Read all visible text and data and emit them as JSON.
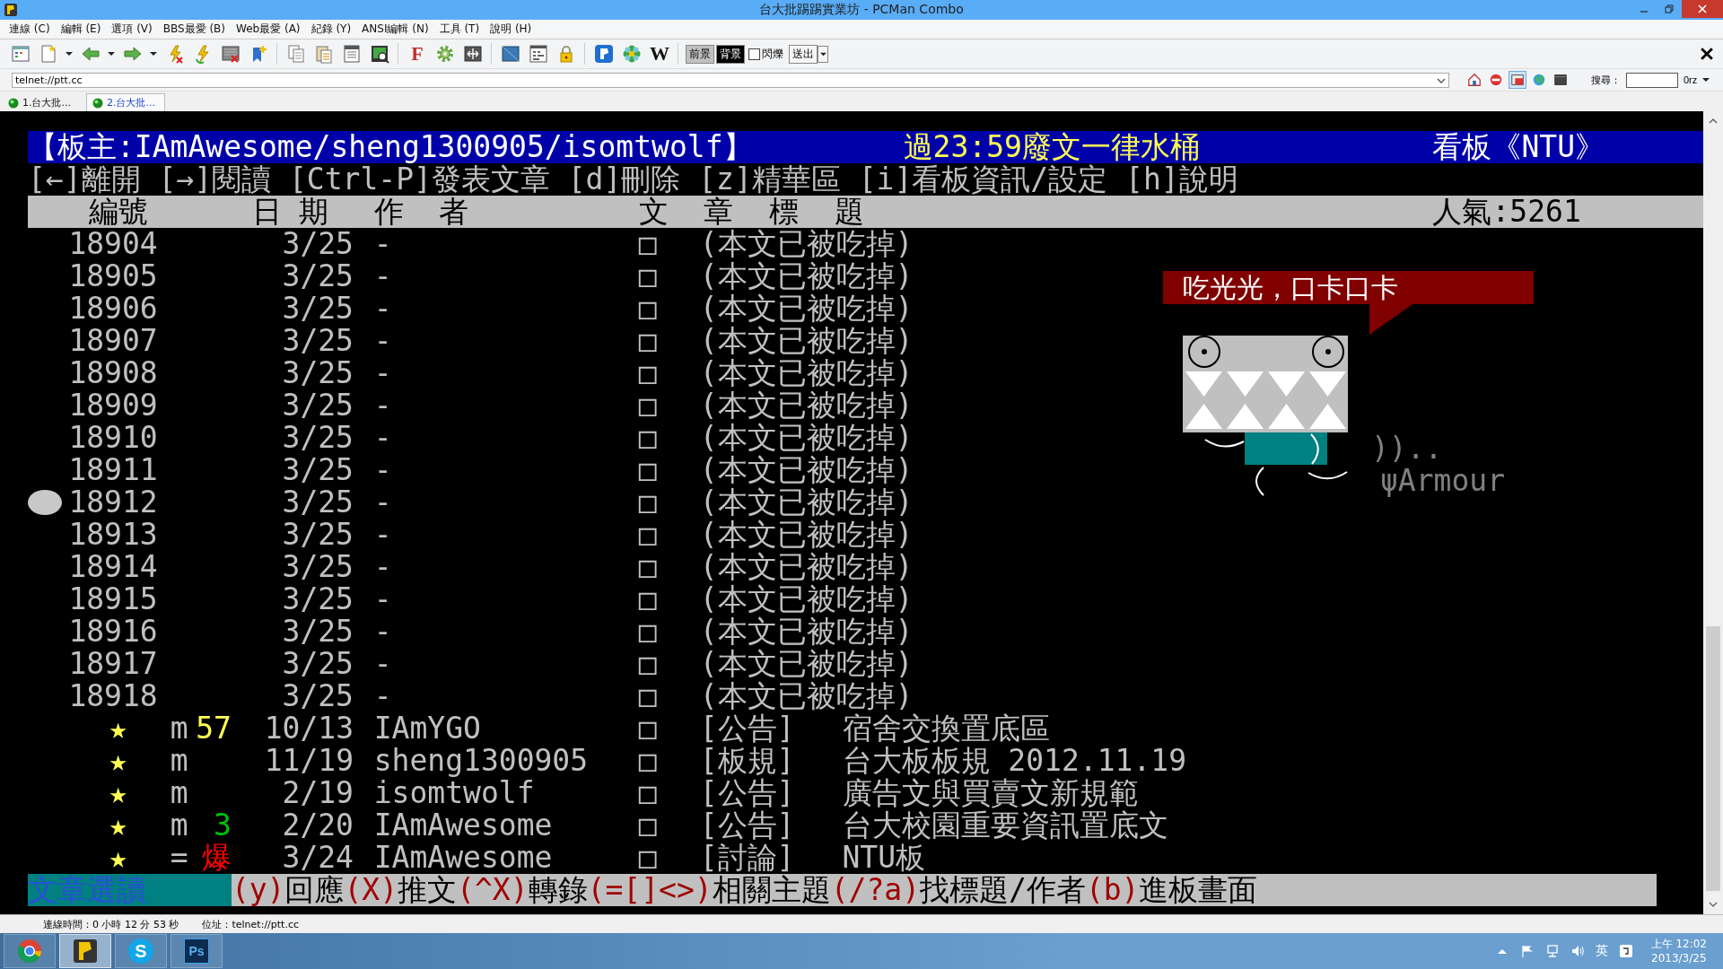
{
  "window": {
    "title": "台大批踢踢實業坊 - PCMan Combo"
  },
  "menu": [
    "連線 (C)",
    "編輯 (E)",
    "選項 (V)",
    "BBS最愛 (B)",
    "Web最愛 (A)",
    "紀錄 (Y)",
    "ANSI編輯 (N)",
    "工具 (T)",
    "說明 (H)"
  ],
  "toolbar": {
    "letters": [
      "F",
      "W"
    ],
    "color_buttons": [
      {
        "label": "前景",
        "color": "#c0c0c0"
      },
      {
        "label": "背景",
        "color": "#000000"
      }
    ],
    "blink": {
      "label": "閃爍",
      "checked": false
    },
    "send": {
      "label": "送出"
    }
  },
  "address": {
    "url": "telnet://ptt.cc"
  },
  "search": {
    "label": "搜尋：",
    "shortener": "0rz"
  },
  "tabs": [
    {
      "label": "1.台大批...",
      "selected": false
    },
    {
      "label": "2.台大批...",
      "selected": true
    }
  ],
  "terminal": {
    "header": {
      "moderator": "【板主:IAmAwesome/sheng1300905/isomtwolf】",
      "notice": "過23:59廢文一律水桶",
      "board": "看板《NTU》"
    },
    "help_line": "[←]離開 [→]閱讀 [Ctrl-P]發表文章 [d]刪除 [z]精華區 [i]看板資訊/設定 [h]說明",
    "columns": [
      "編號",
      "日 期",
      "作  者",
      "文  章  標  題"
    ],
    "popularity": "人氣:5261",
    "posts": [
      {
        "number": "18904",
        "date": "3/25",
        "author": "-",
        "mark": "□",
        "title": "(本文已被吃掉)",
        "selected": false
      },
      {
        "number": "18905",
        "date": "3/25",
        "author": "-",
        "mark": "□",
        "title": "(本文已被吃掉)",
        "selected": false
      },
      {
        "number": "18906",
        "date": "3/25",
        "author": "-",
        "mark": "□",
        "title": "(本文已被吃掉)",
        "selected": false
      },
      {
        "number": "18907",
        "date": "3/25",
        "author": "-",
        "mark": "□",
        "title": "(本文已被吃掉)",
        "selected": false
      },
      {
        "number": "18908",
        "date": "3/25",
        "author": "-",
        "mark": "□",
        "title": "(本文已被吃掉)",
        "selected": false
      },
      {
        "number": "18909",
        "date": "3/25",
        "author": "-",
        "mark": "□",
        "title": "(本文已被吃掉)",
        "selected": false
      },
      {
        "number": "18910",
        "date": "3/25",
        "author": "-",
        "mark": "□",
        "title": "(本文已被吃掉)",
        "selected": false
      },
      {
        "number": "18911",
        "date": "3/25",
        "author": "-",
        "mark": "□",
        "title": "(本文已被吃掉)",
        "selected": false
      },
      {
        "number": "18912",
        "date": "3/25",
        "author": "-",
        "mark": "□",
        "title": "(本文已被吃掉)",
        "selected": true
      },
      {
        "number": "18913",
        "date": "3/25",
        "author": "-",
        "mark": "□",
        "title": "(本文已被吃掉)",
        "selected": false
      },
      {
        "number": "18914",
        "date": "3/25",
        "author": "-",
        "mark": "□",
        "title": "(本文已被吃掉)",
        "selected": false
      },
      {
        "number": "18915",
        "date": "3/25",
        "author": "-",
        "mark": "□",
        "title": "(本文已被吃掉)",
        "selected": false
      },
      {
        "number": "18916",
        "date": "3/25",
        "author": "-",
        "mark": "□",
        "title": "(本文已被吃掉)",
        "selected": false
      },
      {
        "number": "18917",
        "date": "3/25",
        "author": "-",
        "mark": "□",
        "title": "(本文已被吃掉)",
        "selected": false
      },
      {
        "number": "18918",
        "date": "3/25",
        "author": "-",
        "mark": "□",
        "title": "(本文已被吃掉)",
        "selected": false
      }
    ],
    "pinned": [
      {
        "star": "★",
        "flag": "m",
        "count": "57",
        "color": "#ffff55",
        "date": "10/13",
        "author": "IAmYGO",
        "mark": "□",
        "category": "[公告]",
        "title": "宿舍交換置底區"
      },
      {
        "star": "★",
        "flag": "m",
        "date": "11/19",
        "author": "sheng1300905",
        "mark": "□",
        "category": "[板規]",
        "title": "台大板板規 2012.11.19"
      },
      {
        "star": "★",
        "flag": "m",
        "date": "2/19",
        "author": "isomtwolf",
        "mark": "□",
        "category": "[公告]",
        "title": "廣告文與買賣文新規範"
      },
      {
        "star": "★",
        "flag": "m",
        "count": "3",
        "color": "#00c000",
        "date": "2/20",
        "author": "IAmAwesome",
        "mark": "□",
        "category": "[公告]",
        "title": "台大校園重要資訊置底文"
      },
      {
        "star": "★",
        "flag": "=",
        "count": "爆",
        "color": "#ff0000",
        "date": "3/24",
        "author": "IAmAwesome",
        "mark": "□",
        "category": "[討論]",
        "title": "NTU板"
      }
    ],
    "footer": {
      "mode": "文章選讀",
      "hints": [
        {
          "key": "(y)",
          "label": "回應"
        },
        {
          "key": "(X)",
          "label": "推文"
        },
        {
          "key": "(^X)",
          "label": "轉錄"
        },
        {
          "key": "(=[]<>)",
          "label": "相關主題"
        },
        {
          "key": "(/?a)",
          "label": "找標題/作者"
        },
        {
          "key": "(b)",
          "label": "進板畫面"
        }
      ]
    },
    "art": {
      "bubble": "吃光光，口卡口卡",
      "murmur": "))..",
      "signature": "ψArmour"
    }
  },
  "status_bar": [
    "連線時間：0 小時 12 分 53 秒",
    "位址：telnet://ptt.cc"
  ],
  "taskbar": {
    "apps": [
      {
        "kind": "chrome",
        "active": false
      },
      {
        "kind": "pcman",
        "active": true
      },
      {
        "kind": "skype",
        "glyph": "S",
        "active": false
      },
      {
        "kind": "photoshop",
        "glyph": "Ps",
        "active": false
      }
    ],
    "ime": "英",
    "time": "上午 12:02",
    "date": "2013/3/25"
  }
}
